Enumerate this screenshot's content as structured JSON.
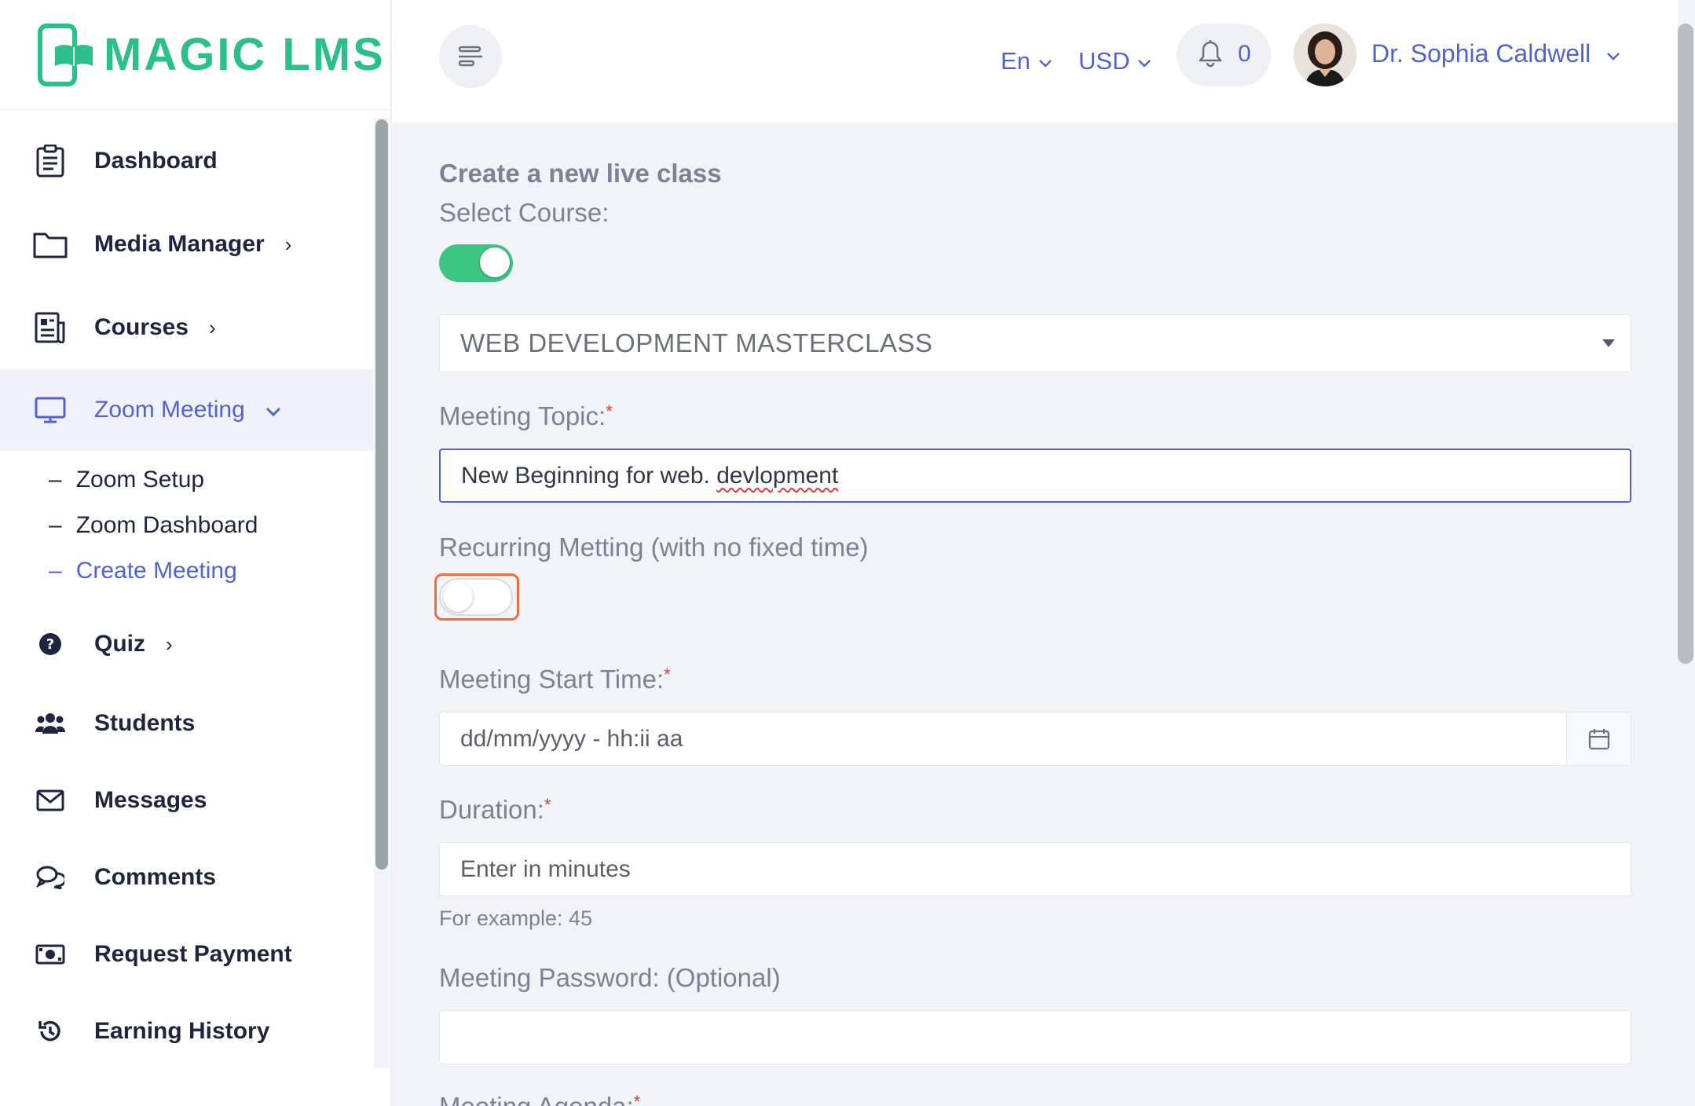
{
  "brand": {
    "name": "MAGIC LMS",
    "color": "#2bbf8a"
  },
  "sidebar": {
    "items": [
      {
        "label": "Dashboard",
        "icon": "clipboard-icon"
      },
      {
        "label": "Media Manager",
        "icon": "folder-icon",
        "chevron": "›"
      },
      {
        "label": "Courses",
        "icon": "newspaper-icon",
        "chevron": "›"
      },
      {
        "label": "Zoom Meeting",
        "icon": "monitor-icon",
        "chevron": "⌄",
        "active": true
      },
      {
        "label": "Quiz",
        "icon": "question-circle-icon",
        "chevron": "›"
      },
      {
        "label": "Students",
        "icon": "users-icon"
      },
      {
        "label": "Messages",
        "icon": "envelope-icon"
      },
      {
        "label": "Comments",
        "icon": "chat-bubbles-icon"
      },
      {
        "label": "Request Payment",
        "icon": "money-bill-icon"
      },
      {
        "label": "Earning History",
        "icon": "history-icon"
      }
    ],
    "zoom_submenu": [
      {
        "label": "Zoom Setup"
      },
      {
        "label": "Zoom Dashboard"
      },
      {
        "label": "Create Meeting",
        "current": true
      }
    ],
    "dash": "–"
  },
  "topbar": {
    "language": "En",
    "currency": "USD",
    "notifications": "0",
    "user_name": "Dr. Sophia Caldwell",
    "accent": "#4f63d2"
  },
  "form": {
    "title": "Create a new live class",
    "select_course_label": "Select Course:",
    "select_course_toggle": true,
    "course_value": "WEB DEVELOPMENT MASTERCLASS",
    "topic_label": "Meeting Topic:",
    "topic_value_plain": "New Beginning for web. ",
    "topic_value_misspelled": "devlopment",
    "recurring_label": "Recurring Metting (with no fixed time)",
    "recurring_toggle": false,
    "start_time_label": "Meeting Start Time:",
    "start_time_placeholder": "dd/mm/yyyy - hh:ii aa",
    "duration_label": "Duration:",
    "duration_placeholder": "Enter in minutes",
    "duration_hint": "For example: 45",
    "password_label": "Meeting Password: (Optional)",
    "password_value": "",
    "agenda_label": "Meeting Agenda:",
    "required_mark": "*"
  },
  "colors": {
    "toggle_on": "#3cc682",
    "focus_ring": "#f26b3a",
    "required": "#e53935"
  }
}
